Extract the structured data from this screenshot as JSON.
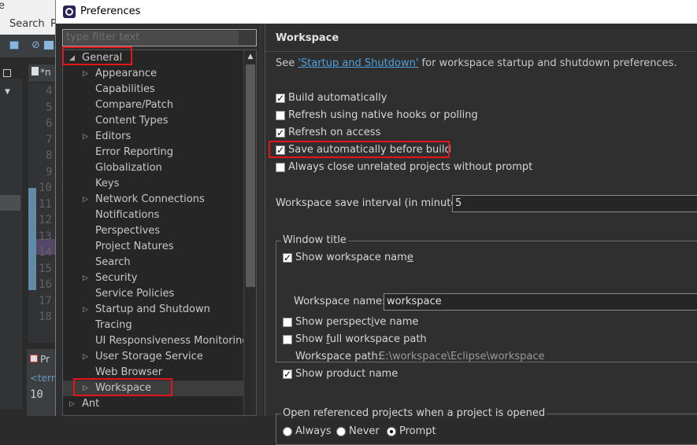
{
  "background_ide": {
    "menu_edit_fragment": "e",
    "menu_search": "Search",
    "menu_p": "P",
    "editor_tab": "*n",
    "line_numbers": [
      "4",
      "5",
      "6",
      "7",
      "8",
      "9",
      "10",
      "11",
      "12",
      "13",
      "14",
      "15",
      "16",
      "17",
      "18"
    ],
    "bottom_tab": "Pr",
    "terminal_label": "<term",
    "terminal_line": "10"
  },
  "dialog": {
    "title": "Preferences",
    "filter_placeholder": "type filter text"
  },
  "tree": {
    "items": [
      {
        "label": "General",
        "indent": 0,
        "expanded": true
      },
      {
        "label": "Appearance",
        "indent": 1,
        "arrow": true
      },
      {
        "label": "Capabilities",
        "indent": 1
      },
      {
        "label": "Compare/Patch",
        "indent": 1
      },
      {
        "label": "Content Types",
        "indent": 1
      },
      {
        "label": "Editors",
        "indent": 1,
        "arrow": true
      },
      {
        "label": "Error Reporting",
        "indent": 1
      },
      {
        "label": "Globalization",
        "indent": 1
      },
      {
        "label": "Keys",
        "indent": 1
      },
      {
        "label": "Network Connections",
        "indent": 1,
        "arrow": true
      },
      {
        "label": "Notifications",
        "indent": 1
      },
      {
        "label": "Perspectives",
        "indent": 1
      },
      {
        "label": "Project Natures",
        "indent": 1
      },
      {
        "label": "Search",
        "indent": 1
      },
      {
        "label": "Security",
        "indent": 1,
        "arrow": true
      },
      {
        "label": "Service Policies",
        "indent": 1
      },
      {
        "label": "Startup and Shutdown",
        "indent": 1,
        "arrow": true
      },
      {
        "label": "Tracing",
        "indent": 1
      },
      {
        "label": "UI Responsiveness Monitoring",
        "indent": 1
      },
      {
        "label": "User Storage Service",
        "indent": 1,
        "arrow": true
      },
      {
        "label": "Web Browser",
        "indent": 1
      },
      {
        "label": "Workspace",
        "indent": 1,
        "arrow": true,
        "selected": true
      },
      {
        "label": "Ant",
        "indent": 0,
        "arrow": true
      }
    ]
  },
  "workspace_page": {
    "heading": "Workspace",
    "see_prefix": "See ",
    "see_link": "'Startup and Shutdown'",
    "see_suffix": " for workspace startup and shutdown preferences.",
    "checkboxes": [
      {
        "label": "Build automatically",
        "checked": true
      },
      {
        "label": "Refresh using native hooks or polling",
        "checked": false
      },
      {
        "label": "Refresh on access",
        "checked": true
      },
      {
        "label": "Save automatically before build",
        "checked": true
      },
      {
        "label": "Always close unrelated projects without prompt",
        "checked": false
      }
    ],
    "save_interval_label": "Workspace save interval (in minutes):",
    "save_interval_value": "5",
    "window_title": {
      "legend": "Window title",
      "show_workspace_name": {
        "label": "Show workspace name",
        "checked": true
      },
      "workspace_name_label": "Workspace name:",
      "workspace_name_value": "workspace",
      "show_perspective_name": {
        "label": "Show perspective name",
        "checked": false
      },
      "show_full_path": {
        "label": "Show full workspace path",
        "checked": false
      },
      "workspace_path_label": "Workspace path:",
      "workspace_path_value": "E:\\workspace\\Eclipse\\workspace",
      "show_product_name": {
        "label": "Show product name",
        "checked": true
      }
    },
    "open_referenced": {
      "legend": "Open referenced projects when a project is opened",
      "options": [
        {
          "label": "Always",
          "selected": false
        },
        {
          "label": "Never",
          "selected": false
        },
        {
          "label": "Prompt",
          "selected": true
        }
      ]
    }
  }
}
